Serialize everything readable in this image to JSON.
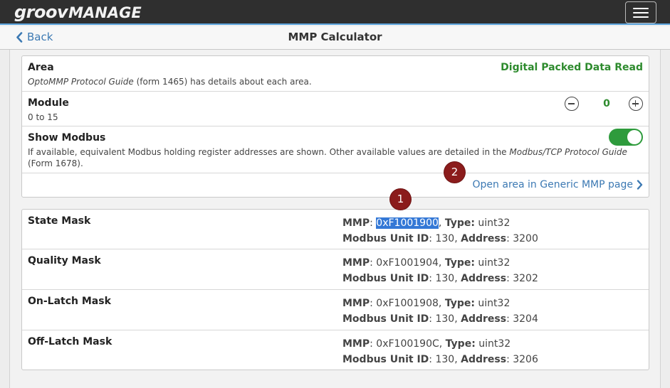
{
  "header": {
    "logo_part1": "groov",
    "logo_part2": "MANAGE"
  },
  "nav": {
    "back_label": "Back",
    "title": "MMP Calculator"
  },
  "settings": {
    "area": {
      "title": "Area",
      "desc_italic": "OptoMMP Protocol Guide",
      "desc_rest": " (form 1465) has details about each area.",
      "value": "Digital Packed Data Read"
    },
    "module": {
      "title": "Module",
      "range": "0 to 15",
      "value": "0"
    },
    "show_modbus": {
      "title": "Show Modbus",
      "desc_a": "If available, equivalent Modbus holding register addresses are shown. Other available values are detailed in the ",
      "desc_italic": "Modbus/TCP Protocol Guide",
      "desc_b": " (Form 1678).",
      "enabled": true
    },
    "open_link": "Open area in Generic MMP page"
  },
  "labels": {
    "mmp": "MMP",
    "type": "Type:",
    "unit_id": "Modbus Unit ID",
    "address": "Address"
  },
  "badges": {
    "one": "1",
    "two": "2"
  },
  "masks": [
    {
      "name": "State Mask",
      "mmp": "0xF1001900",
      "type": "uint32",
      "unit_id": "130",
      "address": "3200"
    },
    {
      "name": "Quality Mask",
      "mmp": "0xF1001904",
      "type": "uint32",
      "unit_id": "130",
      "address": "3202"
    },
    {
      "name": "On-Latch Mask",
      "mmp": "0xF1001908",
      "type": "uint32",
      "unit_id": "130",
      "address": "3204"
    },
    {
      "name": "Off-Latch Mask",
      "mmp": "0xF100190C",
      "type": "uint32",
      "unit_id": "130",
      "address": "3206"
    }
  ],
  "colors": {
    "accent_green": "#2e8b2e",
    "link_blue": "#3c79b3",
    "badge_red": "#8b1c1c",
    "selection_blue": "#3478d6"
  }
}
